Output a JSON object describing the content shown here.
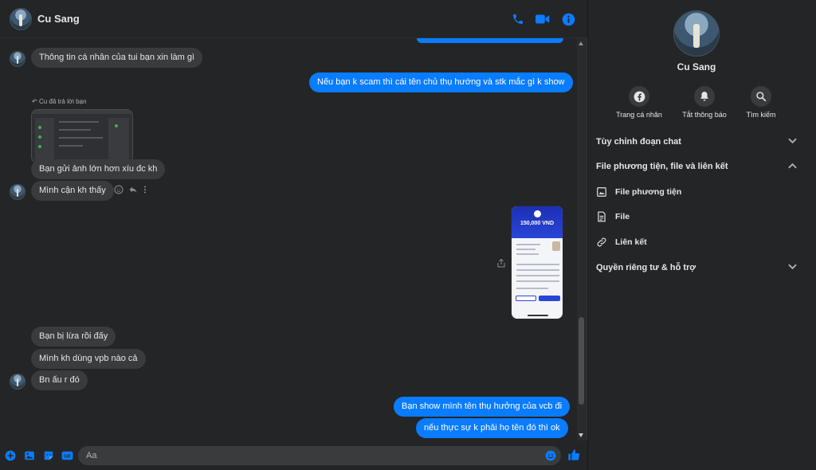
{
  "header": {
    "name": "Cu Sang"
  },
  "messages": {
    "m1": "Thông tin cá nhân của tui bạn xin làm gì",
    "m2": "Nếu bạn k scam thì cái tên chủ thụ hướng và stk mắc gì k show",
    "reply_note": "Cu đã trả lời bạn",
    "m3": "Bạn gửi ảnh lớn hơn xíu đc kh",
    "m4": "Mình cận kh thấy",
    "phone_amount": "150,000 VND",
    "m5": "Bạn bị lừa rồi đấy",
    "m6": "Mình kh dùng vpb nào cả",
    "m7": "Bn ấu r đó",
    "m8": "Bạn show mình tên thụ hưởng của vcb đi",
    "m9": "nếu thực sự k phải họ tên đó thì ok"
  },
  "composer": {
    "placeholder": "Aa"
  },
  "sidebar": {
    "name": "Cu Sang",
    "actions": [
      "Trang cá nhân",
      "Tắt thông báo",
      "Tìm kiếm"
    ],
    "sections": {
      "customize": "Tùy chỉnh đoạn chat",
      "media": "File phương tiện, file và liên kết",
      "media_items": [
        "File phương tiện",
        "File",
        "Liên kết"
      ],
      "privacy": "Quyền riêng tư & hỗ trợ"
    }
  },
  "colors": {
    "accent": "#0a7cff",
    "background": "#242526",
    "bubble_in": "#3a3b3c"
  }
}
